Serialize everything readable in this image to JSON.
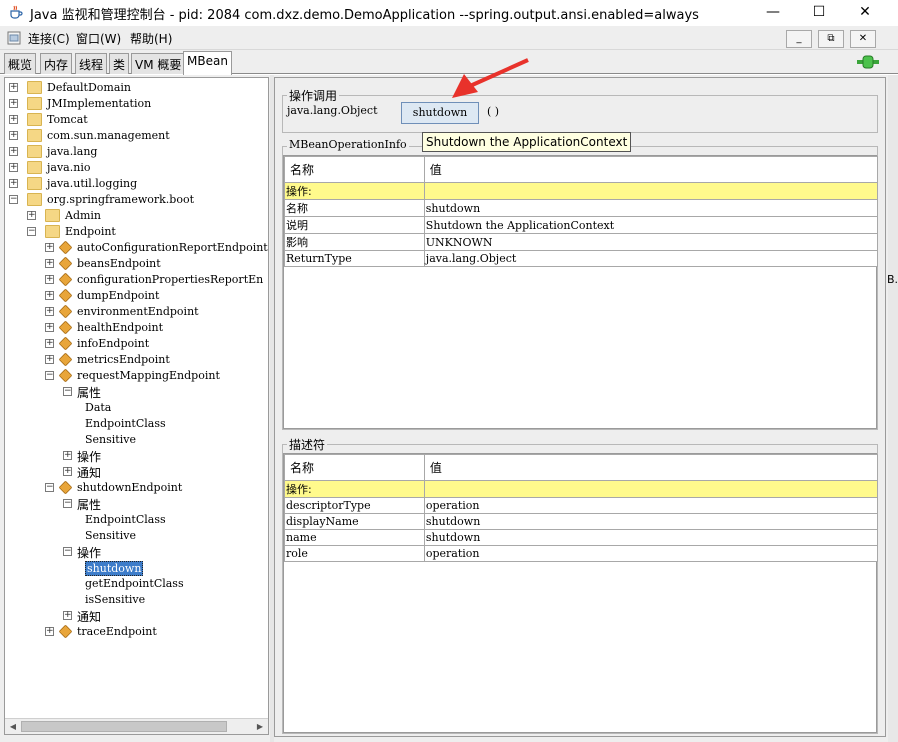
{
  "window": {
    "title": "Java 监视和管理控制台 - pid: 2084 com.dxz.demo.DemoApplication --spring.output.ansi.enabled=always",
    "minimize_icon": "minimize-icon",
    "maximize_icon": "maximize-icon",
    "close_icon": "close-icon"
  },
  "menubar": {
    "items": [
      "连接(C)",
      "窗口(W)",
      "帮助(H)"
    ]
  },
  "tabs": [
    "概览",
    "内存",
    "线程",
    "类",
    "VM 概要",
    "MBean"
  ],
  "active_tab": "MBean",
  "tree": {
    "nodes": [
      {
        "label": "DefaultDomain",
        "type": "folder",
        "expander": "+"
      },
      {
        "label": "JMImplementation",
        "type": "folder",
        "expander": "+"
      },
      {
        "label": "Tomcat",
        "type": "folder",
        "expander": "+"
      },
      {
        "label": "com.sun.management",
        "type": "folder",
        "expander": "+"
      },
      {
        "label": "java.lang",
        "type": "folder",
        "expander": "+"
      },
      {
        "label": "java.nio",
        "type": "folder",
        "expander": "+"
      },
      {
        "label": "java.util.logging",
        "type": "folder",
        "expander": "+"
      },
      {
        "label": "org.springframework.boot",
        "type": "folder",
        "expander": "-"
      },
      {
        "label": "Admin",
        "type": "folder",
        "expander": "+"
      },
      {
        "label": "Endpoint",
        "type": "folder",
        "expander": "-"
      },
      {
        "label": "autoConfigurationReportEndpoint",
        "type": "bean",
        "expander": "+"
      },
      {
        "label": "beansEndpoint",
        "type": "bean",
        "expander": "+"
      },
      {
        "label": "configurationPropertiesReportEn",
        "type": "bean",
        "expander": "+"
      },
      {
        "label": "dumpEndpoint",
        "type": "bean",
        "expander": "+"
      },
      {
        "label": "environmentEndpoint",
        "type": "bean",
        "expander": "+"
      },
      {
        "label": "healthEndpoint",
        "type": "bean",
        "expander": "+"
      },
      {
        "label": "infoEndpoint",
        "type": "bean",
        "expander": "+"
      },
      {
        "label": "metricsEndpoint",
        "type": "bean",
        "expander": "+"
      },
      {
        "label": "requestMappingEndpoint",
        "type": "bean",
        "expander": "-"
      },
      {
        "label": "属性",
        "type": "none",
        "expander": "-"
      },
      {
        "label": "Data",
        "type": "leaf",
        "expander": ""
      },
      {
        "label": "EndpointClass",
        "type": "leaf",
        "expander": ""
      },
      {
        "label": "Sensitive",
        "type": "leaf",
        "expander": ""
      },
      {
        "label": "操作",
        "type": "none",
        "expander": "+"
      },
      {
        "label": "通知",
        "type": "none",
        "expander": "+"
      },
      {
        "label": "shutdownEndpoint",
        "type": "bean",
        "expander": "-"
      },
      {
        "label": "属性",
        "type": "none",
        "expander": "-"
      },
      {
        "label": "EndpointClass",
        "type": "leaf",
        "expander": ""
      },
      {
        "label": "Sensitive",
        "type": "leaf",
        "expander": ""
      },
      {
        "label": "操作",
        "type": "none",
        "expander": "-"
      },
      {
        "label": "shutdown",
        "type": "leaf",
        "expander": "",
        "selected": true
      },
      {
        "label": "getEndpointClass",
        "type": "leaf",
        "expander": ""
      },
      {
        "label": "isSensitive",
        "type": "leaf",
        "expander": ""
      },
      {
        "label": "通知",
        "type": "none",
        "expander": "+"
      },
      {
        "label": "traceEndpoint",
        "type": "bean",
        "expander": "+"
      }
    ]
  },
  "invoke": {
    "group_title": "操作调用",
    "return_type": "java.lang.Object",
    "button_label": "shutdown",
    "params": "( )",
    "tooltip": "Shutdown the ApplicationContext"
  },
  "op_info": {
    "group_title": "MBeanOperationInfo",
    "headers": [
      "名称",
      "值"
    ],
    "section": "操作:",
    "rows": [
      [
        "名称",
        "shutdown"
      ],
      [
        "说明",
        "Shutdown the ApplicationContext"
      ],
      [
        "影响",
        "UNKNOWN"
      ],
      [
        "ReturnType",
        "java.lang.Object"
      ]
    ]
  },
  "descriptor": {
    "group_title": "描述符",
    "headers": [
      "名称",
      "值"
    ],
    "section": "操作:",
    "rows": [
      [
        "descriptorType",
        "operation"
      ],
      [
        "displayName",
        "shutdown"
      ],
      [
        "name",
        "shutdown"
      ],
      [
        "role",
        "operation"
      ]
    ]
  },
  "colors": {
    "highlight_row": "#fffa8c",
    "selection": "#3d7cc9",
    "tooltip_bg": "#ffffe1",
    "annotation_arrow": "#e8322b",
    "connection_icon": "#3aa43a"
  },
  "edge_text": "B."
}
